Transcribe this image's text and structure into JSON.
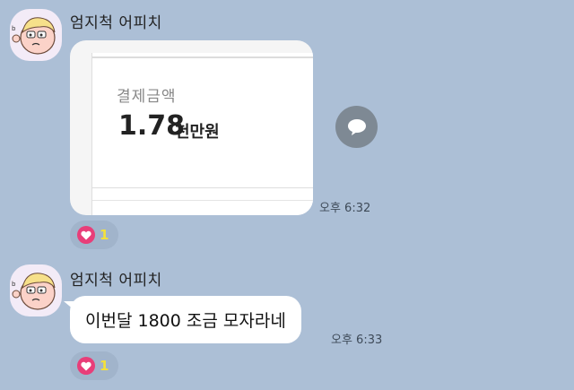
{
  "messages": [
    {
      "sender": "엄지척 어피치",
      "type": "image",
      "image": {
        "label": "결제금액",
        "amount": "1.78",
        "unit": "천만원"
      },
      "time": "오후 6:32",
      "reaction": {
        "icon": "heart-icon",
        "count": "1"
      }
    },
    {
      "sender": "엄지척 어피치",
      "type": "text",
      "text": "이번달 1800 조금 모자라네",
      "time": "오후 6:33",
      "reaction": {
        "icon": "heart-icon",
        "count": "1"
      }
    }
  ],
  "colors": {
    "background": "#acbfd6",
    "bubble": "#ffffff",
    "share_button": "#7e8994",
    "heart": "#e83e79",
    "reaction_count": "#f4e13a"
  },
  "icons": {
    "share": "speech-bubble-icon",
    "avatar": "apeach-avatar"
  }
}
